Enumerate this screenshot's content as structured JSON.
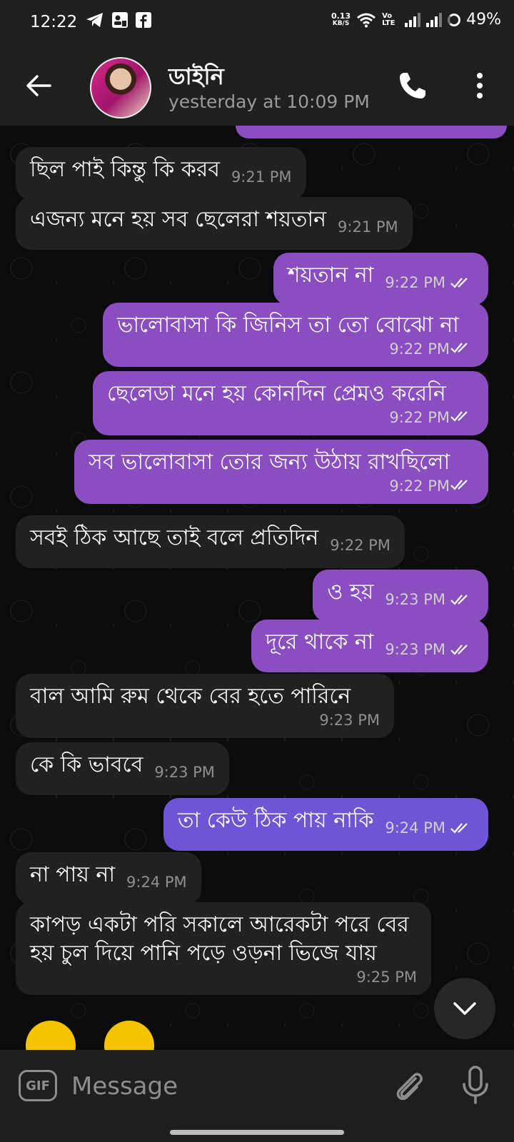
{
  "status_bar": {
    "time": "12:22",
    "net_speed_value": "0.13",
    "net_speed_unit": "KB/S",
    "volte": "Vo LTE",
    "battery": "49%"
  },
  "header": {
    "contact_name": "ডাইনি",
    "last_seen": "yesterday at 10:09 PM"
  },
  "messages": [
    {
      "dir": "in",
      "text": "ছিল পাই কিন্তু কি করব",
      "time": "9:21 PM"
    },
    {
      "dir": "in",
      "text": "এজন্য মনে হয় সব ছেলেরা শয়তান",
      "time": "9:21 PM"
    },
    {
      "dir": "out",
      "text": "শয়তান না",
      "time": "9:22 PM"
    },
    {
      "dir": "out",
      "text": "ভালোবাসা কি জিনিস তা তো বোঝো না",
      "time": "9:22 PM"
    },
    {
      "dir": "out",
      "text": "ছেলেডা মনে হয় কোনদিন প্রেমও করেনি",
      "time": "9:22 PM"
    },
    {
      "dir": "out",
      "text": "সব ভালোবাসা তোর জন্য উঠায় রাখছিলো",
      "time": "9:22 PM"
    },
    {
      "dir": "in",
      "text": "সবই ঠিক আছে তাই বলে প্রতিদিন",
      "time": "9:22 PM"
    },
    {
      "dir": "out",
      "text": "ও হয়",
      "time": "9:23 PM"
    },
    {
      "dir": "out",
      "text": "দূরে থাকে না",
      "time": "9:23 PM"
    },
    {
      "dir": "in",
      "text": "বাল আমি রুম থেকে বের হতে পারিনে",
      "time": "9:23 PM"
    },
    {
      "dir": "in",
      "text": "কে কি ভাববে",
      "time": "9:23 PM"
    },
    {
      "dir": "out",
      "text": "তা কেউ ঠিক পায় নাকি",
      "time": "9:24 PM"
    },
    {
      "dir": "in",
      "text": "না পায় না",
      "time": "9:24 PM"
    },
    {
      "dir": "in",
      "text": "কাপড় একটা পরি সকালে আরেকটা পরে বের হয় চুল দিয়ে পানি পড়ে ওড়না ভিজে যায়",
      "time": "9:25 PM"
    }
  ],
  "composer": {
    "gif_label": "GIF",
    "placeholder": "Message"
  },
  "colors": {
    "outgoing_bubble": "#8a4ec0",
    "incoming_bubble": "#212121",
    "background": "#000000"
  }
}
